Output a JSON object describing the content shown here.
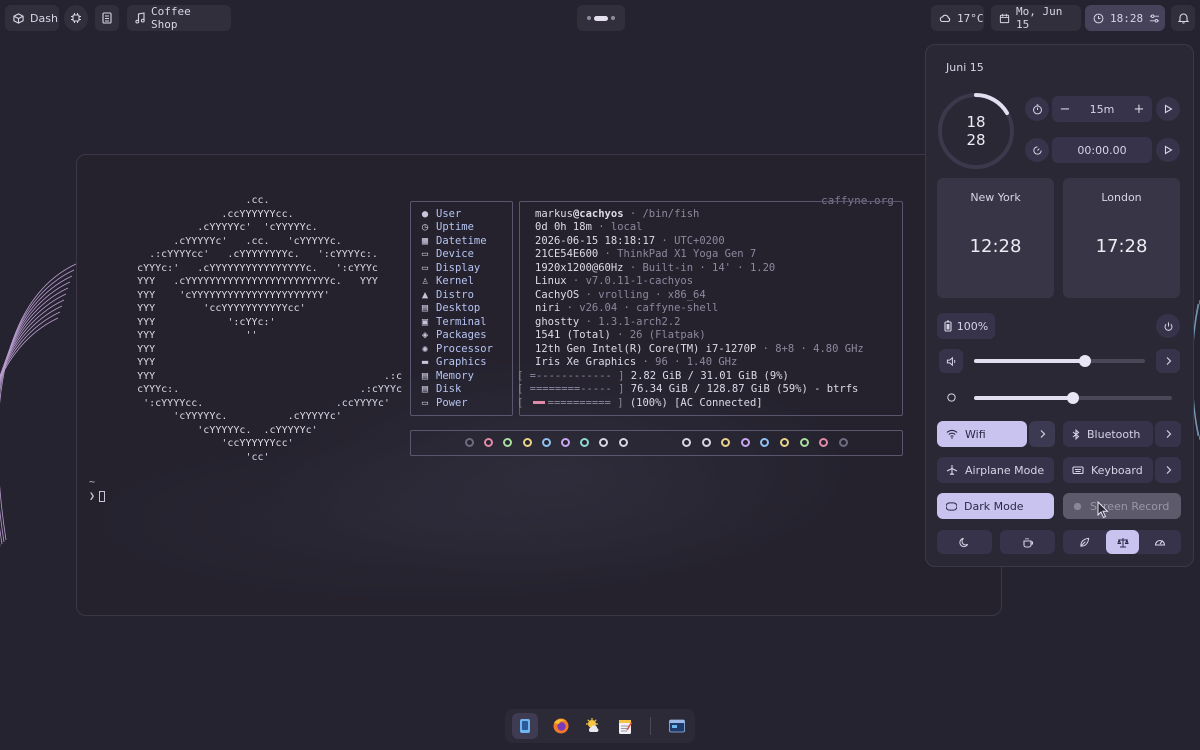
{
  "topbar": {
    "dash_label": "Dash",
    "music_label": "Coffee Shop",
    "weather": "17°C",
    "date": "Mo, Jun 15",
    "time": "18:28"
  },
  "terminal": {
    "ascii_logo": "                      .cc.\n                  .ccYYYYYYcc.\n              .cYYYYYc'  'cYYYYYc.\n          .cYYYYYc'   .cc.   'cYYYYYc.\n      .:cYYYYcc'   .cYYYYYYYYc.   ':cYYYYc:.\n    cYYYc:'   .cYYYYYYYYYYYYYYYYc.   ':cYYYc\n    YYY   .cYYYYYYYYYYYYYYYYYYYYYYYYc.   YYY\n    YYY    'cYYYYYYYYYYYYYYYYYYYYYY'\n    YYY        'ccYYYYYYYYYYYcc'\n    YYY            ':cYYc:'\n    YYY               ''\n    YYY\n    YYY\n    YYY                                      .:c\n    cYYYc:.                              .:cYYYc\n     ':cYYYYcc.                      .ccYYYYc'\n          'cYYYYYc.          .cYYYYYc'\n              'cYYYYYc.  .cYYYYYc'\n                  'ccYYYYYYcc'\n                      'cc'",
    "domain": "caffyne.org",
    "info_keys": [
      "User",
      "Uptime",
      "Datetime",
      "Device",
      "Display",
      "Kernel",
      "Distro",
      "Desktop",
      "Terminal",
      "Packages",
      "Processor",
      "Graphics",
      "Memory",
      "Disk",
      "Power"
    ],
    "user": "markus",
    "host": "@cachyos",
    "user_rest": " · /bin/fish",
    "uptime": "0d 0h 18m",
    "uptime_rest": " · local",
    "datetime": "2026-06-15 18:18:17",
    "datetime_rest": " · UTC+0200",
    "device": "21CE54E600",
    "device_rest": " · ThinkPad X1 Yoga Gen 7",
    "display": "1920x1200@60Hz",
    "display_rest": " · Built-in · 14' · 1.20",
    "kernel": "Linux",
    "kernel_rest": " · v7.0.11-1-cachyos",
    "distro": "CachyOS",
    "distro_rest": " · vrolling · x86_64",
    "desktop": "niri",
    "desktop_rest": " · v26.04 · caffyne-shell",
    "terminal_app": "ghostty",
    "terminal_rest": " · 1.3.1-arch2.2",
    "packages": "1541 (Total)",
    "packages_rest": " · 26 (Flatpak)",
    "processor": "12th Gen Intel(R) Core(TM) i7-1270P",
    "processor_rest": " · 8+8 · 4.80 GHz",
    "graphics": "Iris Xe Graphics",
    "graphics_rest": " · 96 · 1.40 GHz",
    "memory_bar": "[ =------------ ]",
    "memory_text": " 2.82 GiB / 31.01 GiB (9%)",
    "memory_percent": 9,
    "disk_bar": "[ ========----- ]",
    "disk_text": " 76.34 GiB / 128.87 GiB (59%) - btrfs",
    "disk_percent": 59,
    "power_bar_open": "[ ",
    "power_bar_rest": "========== ]",
    "power_text": " (100%) [AC Connected]",
    "power_percent": 100,
    "prompt_tilde": "~",
    "prompt_symbol": "❯"
  },
  "control_center": {
    "date": "Juni 15",
    "clock_hour": "18",
    "clock_minute": "28",
    "timer_value": "15m",
    "stopwatch_value": "00:00.00",
    "cities": [
      {
        "name": "New York",
        "time": "12:28"
      },
      {
        "name": "London",
        "time": "17:28"
      }
    ],
    "battery": "100%",
    "volume_level": 0.65,
    "brightness_level": 0.5,
    "tiles": {
      "wifi": "Wifi",
      "bluetooth": "Bluetooth",
      "airplane": "Airplane Mode",
      "keyboard": "Keyboard",
      "dark_mode": "Dark Mode",
      "screen_record": "Screen Record"
    }
  },
  "colors": {
    "accent": "#c9c3f0",
    "palette_left": [
      "#6f6b80",
      "#e08aa8",
      "#a6dca0",
      "#e8d28a",
      "#8ec0f0",
      "#c8a6f0",
      "#8fd8d0",
      "#d8d4e6",
      "#d8d4e6"
    ],
    "palette_right": [
      "#d8d4e6",
      "#d8d4e6",
      "#e8d28a",
      "#c8a6f0",
      "#8ec0f0",
      "#e8d28a",
      "#a6dca0",
      "#e08aa8",
      "#6f6b80"
    ]
  }
}
